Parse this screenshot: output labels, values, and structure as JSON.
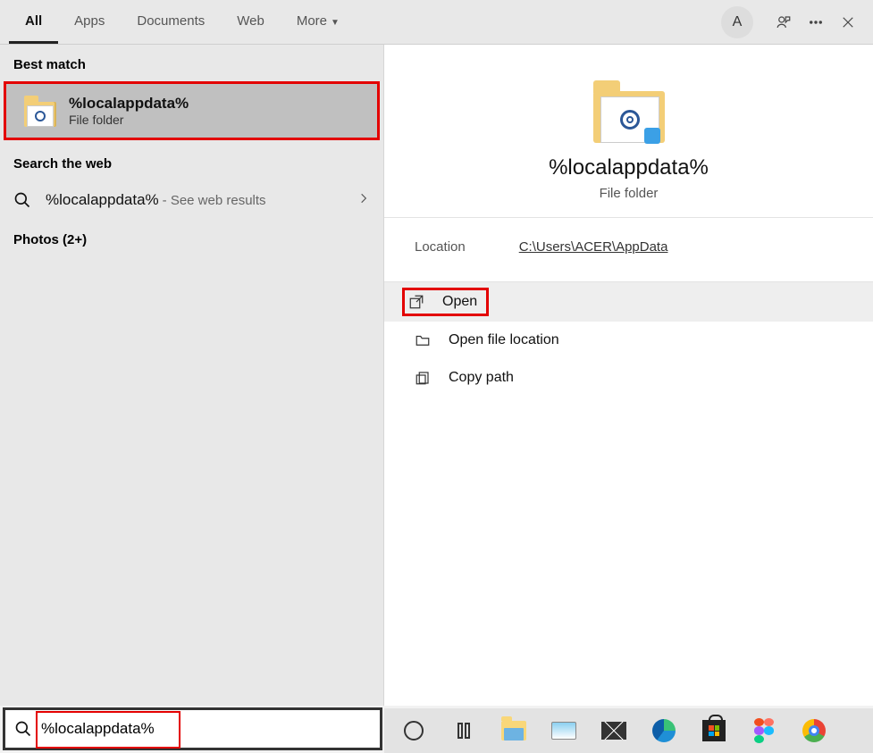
{
  "header": {
    "tabs": [
      "All",
      "Apps",
      "Documents",
      "Web",
      "More"
    ],
    "avatar_letter": "A"
  },
  "left": {
    "best_match_label": "Best match",
    "match": {
      "title": "%localappdata%",
      "subtitle": "File folder"
    },
    "search_web_label": "Search the web",
    "web": {
      "query": "%localappdata%",
      "tail": " - See web results"
    },
    "photos_label": "Photos (2+)"
  },
  "preview": {
    "title": "%localappdata%",
    "subtitle": "File folder",
    "location_label": "Location",
    "location_value": "C:\\Users\\ACER\\AppData",
    "actions": {
      "open": "Open",
      "open_location": "Open file location",
      "copy_path": "Copy path"
    }
  },
  "search": {
    "value": "%localappdata%"
  }
}
